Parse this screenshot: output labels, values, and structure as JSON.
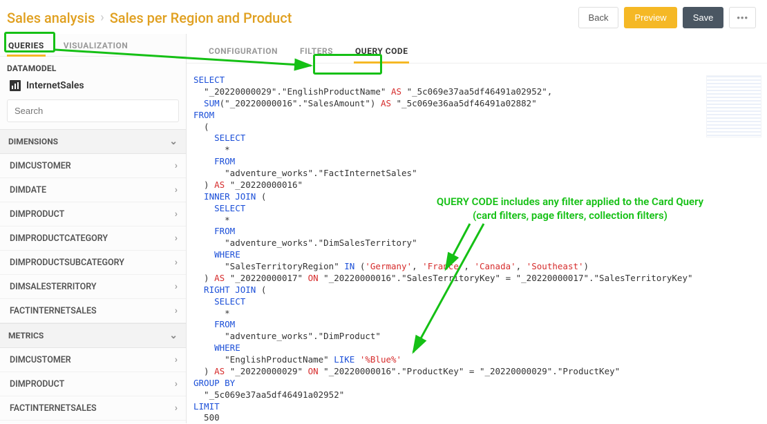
{
  "breadcrumb": {
    "root": "Sales analysis",
    "current": "Sales per Region and Product"
  },
  "actions": {
    "back": "Back",
    "preview": "Preview",
    "save": "Save",
    "more": "•••"
  },
  "primary_tabs": {
    "queries": "QUERIES",
    "visualization": "VISUALIZATION"
  },
  "datamodel": {
    "label": "DATAMODEL",
    "name": "InternetSales",
    "search_placeholder": "Search"
  },
  "panels": {
    "dimensions": {
      "label": "DIMENSIONS",
      "items": [
        "DIMCUSTOMER",
        "DIMDATE",
        "DIMPRODUCT",
        "DIMPRODUCTCATEGORY",
        "DIMPRODUCTSUBCATEGORY",
        "DIMSALESTERRITORY",
        "FACTINTERNETSALES"
      ]
    },
    "metrics": {
      "label": "METRICS",
      "items": [
        "DIMCUSTOMER",
        "DIMPRODUCT",
        "FACTINTERNETSALES"
      ]
    }
  },
  "secondary_tabs": {
    "configuration": "CONFIGURATION",
    "filters": "FILTERS",
    "query_code": "QUERY CODE"
  },
  "annotation": {
    "text": "QUERY CODE includes any filter applied to the Card Query\n(card filters, page filters, collection filters)"
  },
  "sql": {
    "select": "SELECT",
    "col1": "  \"_20220000029\".\"EnglishProductName\" ",
    "as": "AS",
    "alias1": " \"_5c069e37aa5df46491a02952\",",
    "sumOpen": "  SUM",
    "sumArg": "(\"_20220000016\".\"SalesAmount\") ",
    "alias2": " \"_5c069e36aa5df46491a02882\"",
    "from": "FROM",
    "paren_o": "  (",
    "select2": "    SELECT",
    "star": "      *",
    "from2": "    FROM",
    "table_fact": "      \"adventure_works\".\"FactInternetSales\"",
    "paren_c_as1": "  ) ",
    "asAlias1": " \"_20220000016\"",
    "inner_join": "  INNER JOIN ",
    "open2": "(",
    "select3": "    SELECT",
    "star3": "      *",
    "from3": "    FROM",
    "table_dst": "      \"adventure_works\".\"DimSalesTerritory\"",
    "where1": "    WHERE",
    "in_line_a": "      \"SalesTerritoryRegion\" ",
    "in_kw": "IN",
    "in_vals_open": " (",
    "v_germany": "'Germany'",
    "v_france": "'France'",
    "v_canada": "'Canada'",
    "v_southeast": "'Southeast'",
    "in_vals_close": ")",
    "close_as2": "  ) ",
    "asAlias2": " \"_20220000017\" ",
    "on1": "ON",
    "on1_expr": " \"_20220000016\".\"SalesTerritoryKey\" = \"_20220000017\".\"SalesTerritoryKey\"",
    "right_join": "  RIGHT JOIN ",
    "open3": "(",
    "select4": "    SELECT",
    "star4": "      *",
    "from4": "    FROM",
    "table_dp": "      \"adventure_works\".\"DimProduct\"",
    "where2": "    WHERE",
    "like_l": "      \"EnglishProductName\" ",
    "like_kw": "LIKE",
    "like_r_s": " ",
    "like_val": "'%Blue%'",
    "close_as3": "  ) ",
    "asAlias3": " \"_20220000029\" ",
    "on2": "ON",
    "on2_expr": " \"_20220000016\".\"ProductKey\" = \"_20220000029\".\"ProductKey\"",
    "group_by": "GROUP BY",
    "gb_col": "  \"_5c069e37aa5df46491a02952\"",
    "limit": "LIMIT",
    "limit_n": "  500"
  }
}
